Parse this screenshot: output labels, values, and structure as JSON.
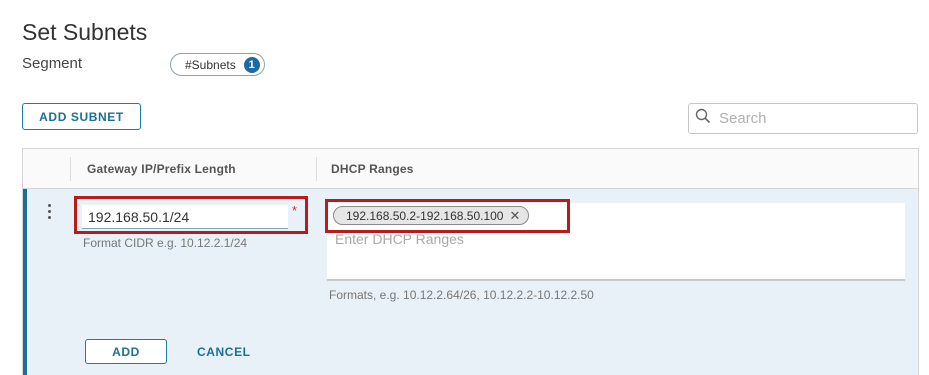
{
  "page": {
    "title": "Set Subnets"
  },
  "segment": {
    "label": "Segment",
    "pill_label": "#Subnets",
    "pill_count": "1"
  },
  "toolbar": {
    "add_subnet_label": "ADD SUBNET",
    "search_placeholder": "Search"
  },
  "grid": {
    "headers": {
      "gateway": "Gateway IP/Prefix Length",
      "dhcp": "DHCP Ranges"
    },
    "row": {
      "gateway_value": "192.168.50.1/24",
      "required_mark": "*",
      "gateway_help": "Format CIDR e.g. 10.12.2.1/24",
      "dhcp_chip": "192.168.50.2-192.168.50.100",
      "dhcp_placeholder": "Enter DHCP Ranges",
      "dhcp_help": "Formats, e.g. 10.12.2.64/26, 10.12.2.2-10.12.2.50",
      "add_label": "ADD",
      "cancel_label": "CANCEL"
    }
  },
  "colors": {
    "accent": "#1b6f95",
    "badge": "#1e6aa6",
    "highlight": "#b71c1c",
    "row_bg": "#e8f1f7",
    "required": "#d42d2d"
  }
}
